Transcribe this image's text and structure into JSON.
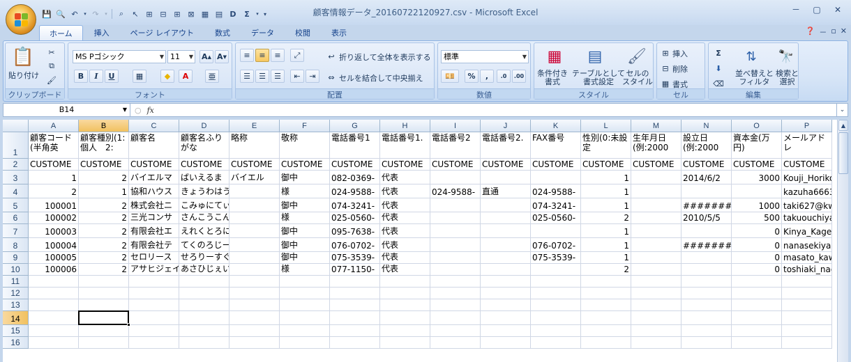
{
  "window": {
    "title": "顧客情報データ_20160722120927.csv - Microsoft Excel",
    "minimize": "－",
    "restore": "▢",
    "close": "✕"
  },
  "ribbon_tabs": [
    "ホーム",
    "挿入",
    "ページ レイアウト",
    "数式",
    "データ",
    "校閲",
    "表示"
  ],
  "ribbon": {
    "clipboard": {
      "paste": "貼り付け",
      "label": "クリップボード"
    },
    "font": {
      "name": "MS Pゴシック",
      "size": "11",
      "label": "フォント",
      "bold": "B",
      "italic": "I",
      "underline": "U"
    },
    "alignment": {
      "wrap_text": "折り返して全体を表示する",
      "merge_center": "セルを結合して中央揃え",
      "label": "配置"
    },
    "number": {
      "format": "標準",
      "label": "数値",
      "percent": "%",
      "comma": ","
    },
    "styles": {
      "conditional": "条件付き\n書式",
      "table": "テーブルとして\n書式設定",
      "cell_styles": "セルの\nスタイル",
      "label": "スタイル"
    },
    "cells": {
      "insert": "挿入",
      "delete": "削除",
      "format": "書式",
      "label": "セル"
    },
    "editing": {
      "sort_filter": "並べ替えと\nフィルタ",
      "find_select": "検索と\n選択",
      "sum": "Σ",
      "label": "編集"
    }
  },
  "formula_bar": {
    "name_box": "B14",
    "fx": "fx",
    "content": ""
  },
  "sheet": {
    "active_cell": "B14",
    "columns": [
      "A",
      "B",
      "C",
      "D",
      "E",
      "F",
      "G",
      "H",
      "I",
      "J",
      "K",
      "L",
      "M",
      "N",
      "O",
      "P"
    ],
    "rows": [
      [
        "顧客コード(半角英",
        "顧客種別(1:個人　2:",
        "顧客名",
        "顧客名ふりがな",
        "略称",
        "敬称",
        "電話番号1",
        "電話番号1.",
        "電話番号2",
        "電話番号2.",
        "FAX番号",
        "性別(0:未設定",
        "生年月日(例:2000",
        "設立日(例:2000",
        "資本金(万円)",
        "メールアドレ"
      ],
      [
        "CUSTOME",
        "CUSTOME",
        "CUSTOME",
        "CUSTOME",
        "CUSTOME",
        "CUSTOME",
        "CUSTOME",
        "CUSTOME",
        "CUSTOME",
        "CUSTOME",
        "CUSTOME",
        "CUSTOME",
        "CUSTOME",
        "CUSTOME",
        "CUSTOME",
        "CUSTOME"
      ],
      [
        "1",
        "2",
        "バイエルマ",
        "ばいえるま",
        "バイエル",
        "御中",
        "082-0369-",
        "代表",
        "",
        "",
        "",
        "1",
        "",
        "2014/6/2",
        "3000",
        "Kouji_Horiko"
      ],
      [
        "2",
        "1",
        "協和ハウス",
        "きょうわはうすだいまる",
        "",
        "様",
        "024-9588-",
        "代表",
        "024-9588-",
        "直通",
        "024-9588-",
        "1",
        "",
        "",
        "",
        "kazuha6663"
      ],
      [
        "100001",
        "2",
        "株式会社ニ",
        "こみゅにてぃーけあさー",
        "",
        "御中",
        "074-3241-",
        "代表",
        "",
        "",
        "074-3241-",
        "1",
        "",
        "########",
        "1000",
        "taki627@kw"
      ],
      [
        "100002",
        "2",
        "三光コンサ",
        "さんこうこんさるてぃんぐ",
        "",
        "様",
        "025-0560-",
        "代表",
        "",
        "",
        "025-0560-",
        "2",
        "",
        "2010/5/5",
        "500",
        "takuouchiya"
      ],
      [
        "100003",
        "2",
        "有限会社エ",
        "えれくとろにくすさんえ",
        "",
        "御中",
        "095-7638-",
        "代表",
        "",
        "",
        "",
        "1",
        "",
        "",
        "0",
        "Kinya_Kagey"
      ],
      [
        "100004",
        "2",
        "有限会社テ",
        "てくのろじーないがいさ",
        "",
        "御中",
        "076-0702-",
        "代表",
        "",
        "",
        "076-0702-",
        "1",
        "",
        "########",
        "0",
        "nanasekiya@"
      ],
      [
        "100005",
        "2",
        "セロリース",
        "せろりーすぐるーぷほー",
        "",
        "御中",
        "075-3539-",
        "代表",
        "",
        "",
        "075-3539-",
        "1",
        "",
        "",
        "0",
        "masato_kaw"
      ],
      [
        "100006",
        "2",
        "アサヒジェイ",
        "あさひじぇいけいおう",
        "",
        "様",
        "077-1150-",
        "代表",
        "",
        "",
        "",
        "2",
        "",
        "",
        "0",
        "toshiaki_nag"
      ]
    ],
    "row_numbers": [
      "1",
      "2",
      "3",
      "4",
      "5",
      "6",
      "7",
      "8",
      "9",
      "10",
      "11",
      "12",
      "13",
      "14",
      "15",
      "16"
    ]
  }
}
